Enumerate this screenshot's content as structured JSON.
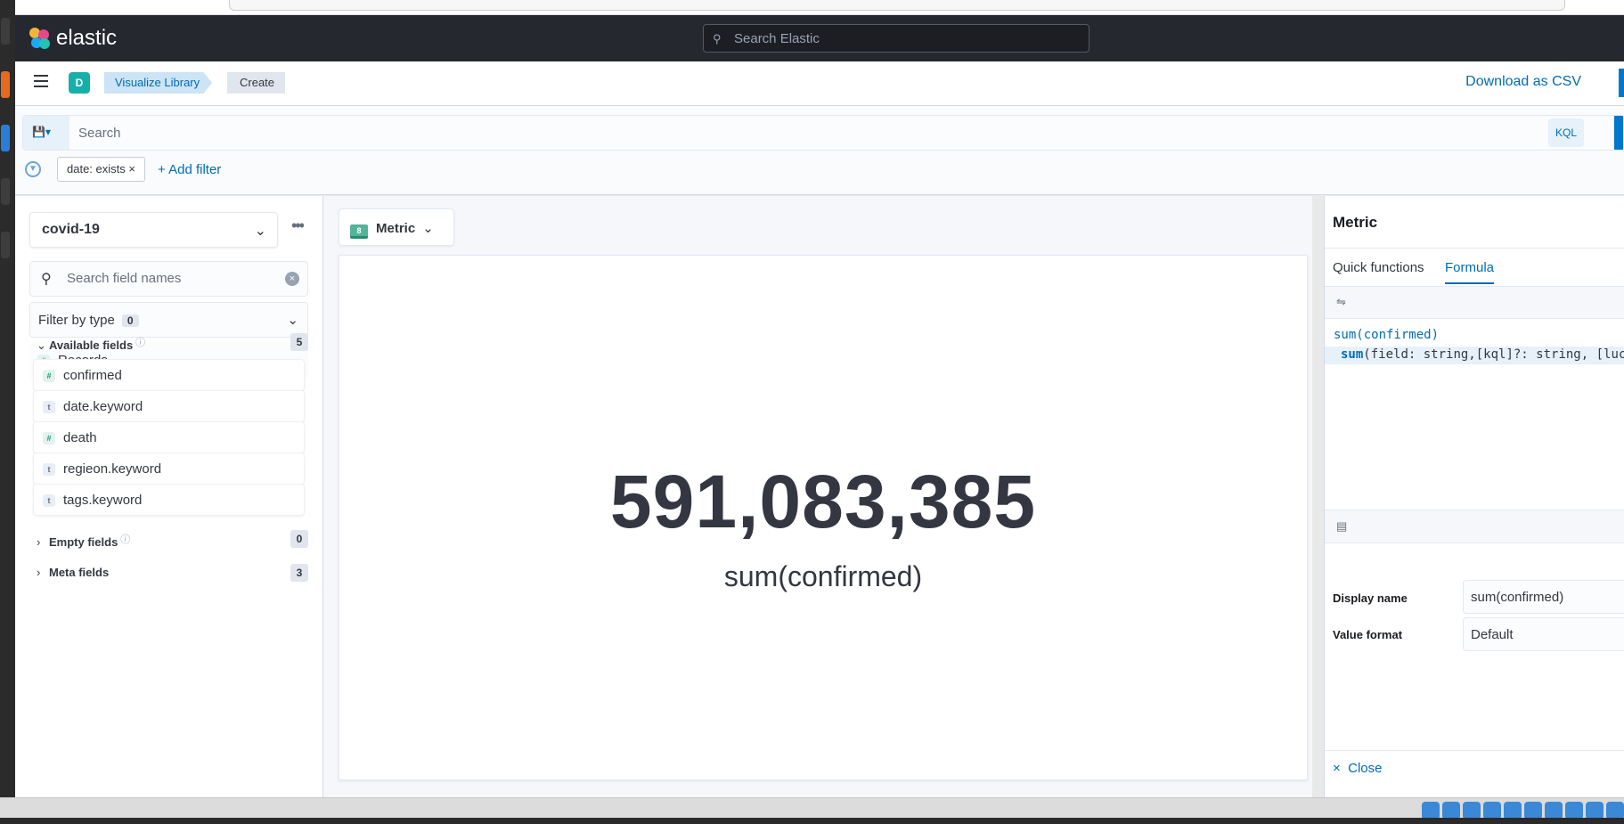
{
  "header": {
    "brand": "elastic",
    "global_search_placeholder": "Search Elastic"
  },
  "breadcrumbs": {
    "space_initial": "D",
    "items": [
      "Visualize Library",
      "Create"
    ],
    "download_label": "Download as CSV"
  },
  "query": {
    "placeholder": "Search",
    "language_label": "KQL",
    "filter_pill": "date: exists",
    "filter_pill_close": "×",
    "add_filter_label": "+ Add filter"
  },
  "datasource": {
    "index_pattern": "covid-19",
    "field_search_placeholder": "Search field names",
    "filter_by_type_label": "Filter by type",
    "filter_by_type_count": "0",
    "records_label": "Records",
    "available_label": "Available fields",
    "available_count": "5",
    "fields": [
      {
        "name": "confirmed",
        "type": "#"
      },
      {
        "name": "date.keyword",
        "type": "t"
      },
      {
        "name": "death",
        "type": "#"
      },
      {
        "name": "regieon.keyword",
        "type": "t"
      },
      {
        "name": "tags.keyword",
        "type": "t"
      }
    ],
    "empty_label": "Empty fields",
    "empty_count": "0",
    "meta_label": "Meta fields",
    "meta_count": "3"
  },
  "workspace": {
    "vis_type": "Metric",
    "metric_value": "591,083,385",
    "metric_label": "sum(confirmed)"
  },
  "flyout": {
    "title": "Metric",
    "tabs": [
      "Quick functions",
      "Formula"
    ],
    "active_tab": "Formula",
    "formula": "sum(confirmed)",
    "suggestion_fn": "sum",
    "suggestion_signature": "(field: string,[kql]?: string, [lucene]?: string): number",
    "display_name_label": "Display name",
    "display_name_value": "sum(confirmed)",
    "value_format_label": "Value format",
    "value_format_value": "Default",
    "close_label": "Close"
  },
  "colors": {
    "accent": "#006bb8",
    "header_bg": "#25282f",
    "space_badge": "#16b0a8"
  }
}
